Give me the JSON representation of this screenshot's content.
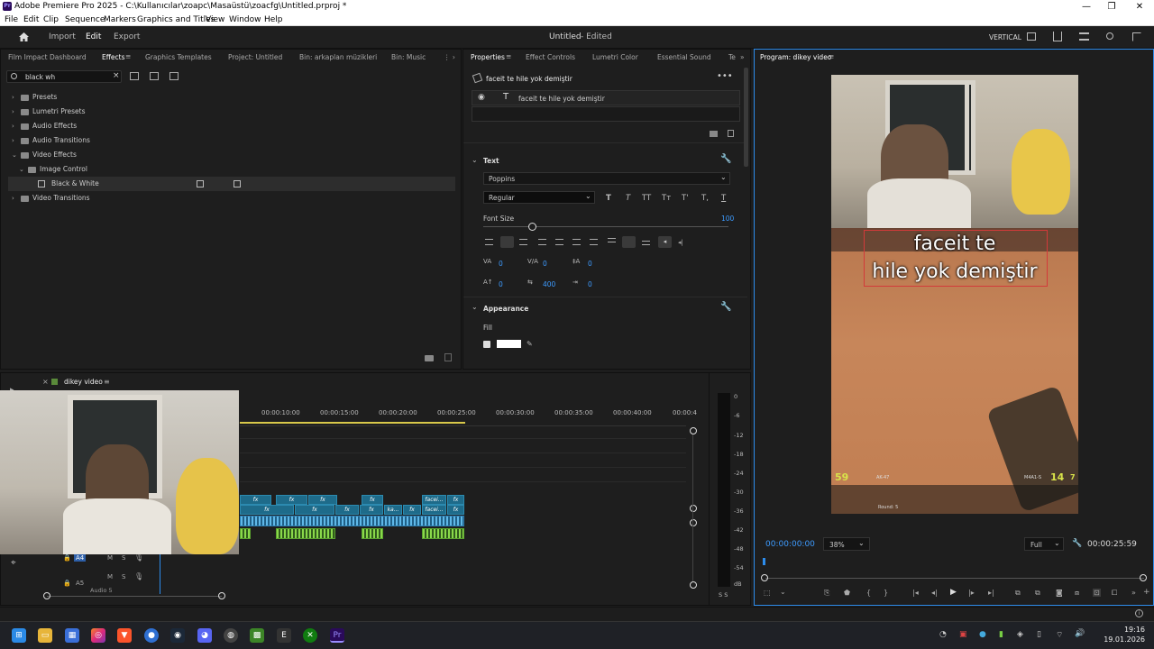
{
  "window": {
    "title": "Adobe Premiere Pro 2025 - C:\\Kullanıcılar\\zoapc\\Masaüstü\\zoacfg\\Untitled.prproj *",
    "app_icon": "Pr",
    "controls": [
      "—",
      "❐",
      "✕"
    ]
  },
  "menu": [
    "File",
    "Edit",
    "Clip",
    "Sequence",
    "Markers",
    "Graphics and Titles",
    "View",
    "Window",
    "Help"
  ],
  "header": {
    "nav": [
      "Import",
      "Edit",
      "Export"
    ],
    "project_title": "Untitled",
    "project_status": "- Edited",
    "vertical_label": "VERTICAL"
  },
  "effects_panel": {
    "tabs": [
      "Film Impact Dashboard",
      "Effects",
      "Graphics Templates",
      "Project: Untitled",
      "Bin: arkaplan müzikleri",
      "Bin: Music"
    ],
    "search_value": "black wh",
    "tree": [
      {
        "label": "Presets",
        "chev": "›"
      },
      {
        "label": "Lumetri Presets",
        "chev": "›"
      },
      {
        "label": "Audio Effects",
        "chev": "›"
      },
      {
        "label": "Audio Transitions",
        "chev": "›"
      },
      {
        "label": "Video Effects",
        "chev": "⌄"
      },
      {
        "label": "Image Control",
        "chev": "⌄"
      },
      {
        "label": "Black & White",
        "chev": ""
      },
      {
        "label": "Video Transitions",
        "chev": "›"
      }
    ]
  },
  "properties_panel": {
    "tabs": [
      "Properties",
      "Effect Controls",
      "Lumetri Color",
      "Essential Sound",
      "Te"
    ],
    "layer_title": "faceit te hile yok demiştir",
    "layer_item": "faceit te hile yok demiştir",
    "text_section": "Text",
    "font": "Poppins",
    "font_style": "Regular",
    "style_buttons": [
      "T",
      "T",
      "TT",
      "Tт",
      "T'",
      "T,",
      "T"
    ],
    "font_size_label": "Font Size",
    "font_size_value": "100",
    "font_size_fraction": 0.1,
    "metrics": [
      "0",
      "0",
      "0",
      "0",
      "400",
      "0"
    ],
    "appearance_section": "Appearance",
    "fill_label": "Fill"
  },
  "program_monitor": {
    "title": "Program: dikey video",
    "caption_line1": "faceit te",
    "caption_line2": "hile yok demiştir",
    "timecode_current": "00:00:00:00",
    "zoom": "38%",
    "quality": "Full",
    "timecode_duration": "00:00:25:59",
    "hud": {
      "health": "59",
      "ammo": "14",
      "ammo_reserve": "7",
      "weapon_left": "AK-47",
      "weapon_right": "M4A1-S",
      "round": "Round: 5"
    }
  },
  "timeline": {
    "sequence_name": "dikey video",
    "ruler": [
      "00:00:10:00",
      "00:00:15:00",
      "00:00:20:00",
      "00:00:25:00",
      "00:00:30:00",
      "00:00:35:00",
      "00:00:40:00",
      "00:00:4"
    ],
    "clip_labels": [
      "fx",
      "facei...",
      "ka..."
    ],
    "track_a4": "A4",
    "track_a5": "A5",
    "track_a5_name": "Audio 5",
    "track_m": "M",
    "track_s": "S",
    "meter_db": [
      "0",
      "-6",
      "-12",
      "-18",
      "-24",
      "-30",
      "-36",
      "-42",
      "-48",
      "-54",
      "dB"
    ],
    "meter_footer": "S S"
  },
  "taskbar": {
    "time": "19:16",
    "date": "19.01.2026"
  },
  "colors": {
    "accent": "#2d8ceb",
    "panel": "#1e1e1e",
    "clip_video": "#1e6b8a",
    "clip_audio_green": "#305a1c"
  }
}
